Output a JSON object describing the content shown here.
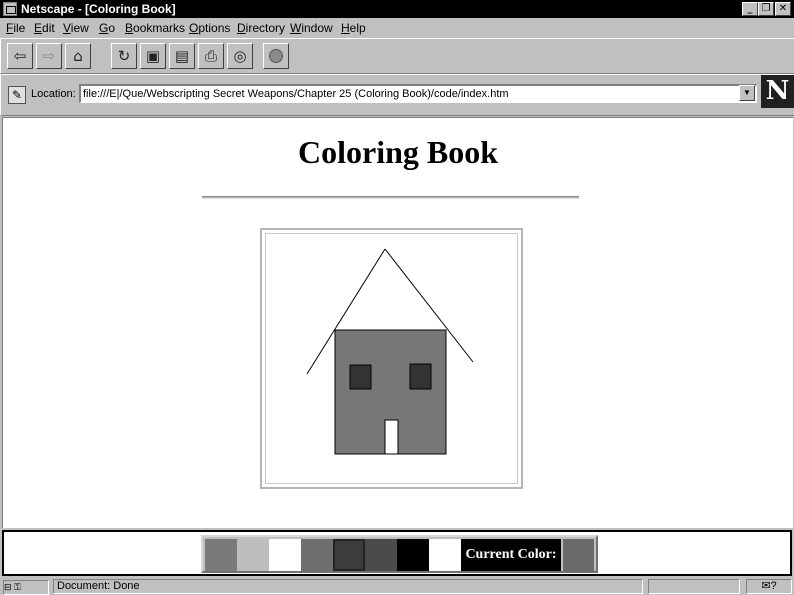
{
  "window": {
    "title": "Netscape - [Coloring Book]",
    "minimize_icon": "minimize-icon",
    "restore_icon": "restore-icon",
    "close_icon": "close-icon"
  },
  "menu": {
    "items": [
      {
        "label": "File",
        "accel": "F"
      },
      {
        "label": "Edit",
        "accel": "E"
      },
      {
        "label": "View",
        "accel": "V"
      },
      {
        "label": "Go",
        "accel": "G"
      },
      {
        "label": "Bookmarks",
        "accel": "B"
      },
      {
        "label": "Options",
        "accel": "O"
      },
      {
        "label": "Directory",
        "accel": "D"
      },
      {
        "label": "Window",
        "accel": "W"
      },
      {
        "label": "Help",
        "accel": "H"
      }
    ]
  },
  "toolbar": {
    "buttons": [
      {
        "name": "back",
        "icon": "back-arrow-icon",
        "glyph": "⇦",
        "enabled": true
      },
      {
        "name": "forward",
        "icon": "forward-arrow-icon",
        "glyph": "⇨",
        "enabled": false
      },
      {
        "name": "home",
        "icon": "home-icon",
        "glyph": "⌂",
        "enabled": true
      },
      {
        "name": "reload",
        "icon": "reload-icon",
        "glyph": "↻",
        "enabled": true
      },
      {
        "name": "images",
        "icon": "images-icon",
        "glyph": "▣",
        "enabled": true
      },
      {
        "name": "open",
        "icon": "open-icon",
        "glyph": "▤",
        "enabled": true
      },
      {
        "name": "print",
        "icon": "print-icon",
        "glyph": "⎙",
        "enabled": true
      },
      {
        "name": "find",
        "icon": "find-binoculars-icon",
        "glyph": "◎",
        "enabled": true
      },
      {
        "name": "stop",
        "icon": "stop-icon",
        "glyph": "",
        "enabled": false
      }
    ]
  },
  "location": {
    "label": "Location:",
    "url": "file:///E|/Que/Webscripting Secret Weapons/Chapter 25 (Coloring Book)/code/index.htm",
    "dropdown_glyph": "▼"
  },
  "logo": {
    "letter": "N"
  },
  "page": {
    "heading": "Coloring Book",
    "drawing": {
      "house_wall_color": "#777777",
      "window_color": "#333333",
      "door_color": "#ffffff"
    }
  },
  "palette": {
    "swatches": [
      "#7a7a7a",
      "#bdbdbd",
      "#ffffff",
      "#6f6f6f",
      "#3c3c3c",
      "#4b4b4b",
      "#000000",
      "#ffffff"
    ],
    "current_label": "Current Color:",
    "current_color": "#6a6a6a"
  },
  "status": {
    "text": "Document: Done",
    "icons_glyph": "⊟ ⚿",
    "mail_glyph": "✉?"
  }
}
